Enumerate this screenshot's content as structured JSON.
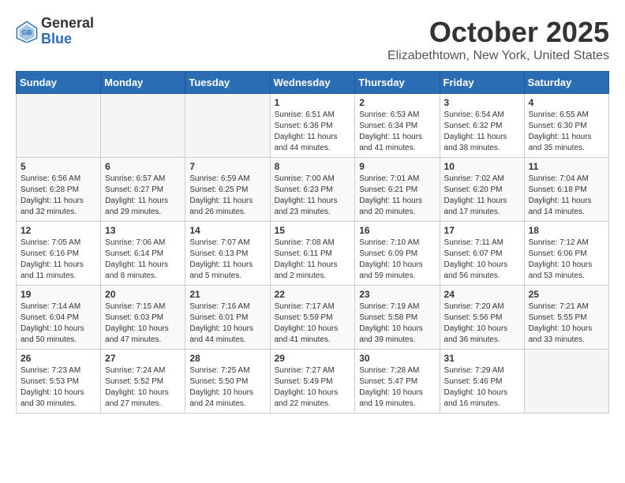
{
  "header": {
    "logo": {
      "general": "General",
      "blue": "Blue"
    },
    "title": "October 2025",
    "location": "Elizabethtown, New York, United States"
  },
  "days_of_week": [
    "Sunday",
    "Monday",
    "Tuesday",
    "Wednesday",
    "Thursday",
    "Friday",
    "Saturday"
  ],
  "weeks": [
    [
      {
        "day": "",
        "info": ""
      },
      {
        "day": "",
        "info": ""
      },
      {
        "day": "",
        "info": ""
      },
      {
        "day": "1",
        "info": "Sunrise: 6:51 AM\nSunset: 6:36 PM\nDaylight: 11 hours and 44 minutes."
      },
      {
        "day": "2",
        "info": "Sunrise: 6:53 AM\nSunset: 6:34 PM\nDaylight: 11 hours and 41 minutes."
      },
      {
        "day": "3",
        "info": "Sunrise: 6:54 AM\nSunset: 6:32 PM\nDaylight: 11 hours and 38 minutes."
      },
      {
        "day": "4",
        "info": "Sunrise: 6:55 AM\nSunset: 6:30 PM\nDaylight: 11 hours and 35 minutes."
      }
    ],
    [
      {
        "day": "5",
        "info": "Sunrise: 6:56 AM\nSunset: 6:28 PM\nDaylight: 11 hours and 32 minutes."
      },
      {
        "day": "6",
        "info": "Sunrise: 6:57 AM\nSunset: 6:27 PM\nDaylight: 11 hours and 29 minutes."
      },
      {
        "day": "7",
        "info": "Sunrise: 6:59 AM\nSunset: 6:25 PM\nDaylight: 11 hours and 26 minutes."
      },
      {
        "day": "8",
        "info": "Sunrise: 7:00 AM\nSunset: 6:23 PM\nDaylight: 11 hours and 23 minutes."
      },
      {
        "day": "9",
        "info": "Sunrise: 7:01 AM\nSunset: 6:21 PM\nDaylight: 11 hours and 20 minutes."
      },
      {
        "day": "10",
        "info": "Sunrise: 7:02 AM\nSunset: 6:20 PM\nDaylight: 11 hours and 17 minutes."
      },
      {
        "day": "11",
        "info": "Sunrise: 7:04 AM\nSunset: 6:18 PM\nDaylight: 11 hours and 14 minutes."
      }
    ],
    [
      {
        "day": "12",
        "info": "Sunrise: 7:05 AM\nSunset: 6:16 PM\nDaylight: 11 hours and 11 minutes."
      },
      {
        "day": "13",
        "info": "Sunrise: 7:06 AM\nSunset: 6:14 PM\nDaylight: 11 hours and 8 minutes."
      },
      {
        "day": "14",
        "info": "Sunrise: 7:07 AM\nSunset: 6:13 PM\nDaylight: 11 hours and 5 minutes."
      },
      {
        "day": "15",
        "info": "Sunrise: 7:08 AM\nSunset: 6:11 PM\nDaylight: 11 hours and 2 minutes."
      },
      {
        "day": "16",
        "info": "Sunrise: 7:10 AM\nSunset: 6:09 PM\nDaylight: 10 hours and 59 minutes."
      },
      {
        "day": "17",
        "info": "Sunrise: 7:11 AM\nSunset: 6:07 PM\nDaylight: 10 hours and 56 minutes."
      },
      {
        "day": "18",
        "info": "Sunrise: 7:12 AM\nSunset: 6:06 PM\nDaylight: 10 hours and 53 minutes."
      }
    ],
    [
      {
        "day": "19",
        "info": "Sunrise: 7:14 AM\nSunset: 6:04 PM\nDaylight: 10 hours and 50 minutes."
      },
      {
        "day": "20",
        "info": "Sunrise: 7:15 AM\nSunset: 6:03 PM\nDaylight: 10 hours and 47 minutes."
      },
      {
        "day": "21",
        "info": "Sunrise: 7:16 AM\nSunset: 6:01 PM\nDaylight: 10 hours and 44 minutes."
      },
      {
        "day": "22",
        "info": "Sunrise: 7:17 AM\nSunset: 5:59 PM\nDaylight: 10 hours and 41 minutes."
      },
      {
        "day": "23",
        "info": "Sunrise: 7:19 AM\nSunset: 5:58 PM\nDaylight: 10 hours and 39 minutes."
      },
      {
        "day": "24",
        "info": "Sunrise: 7:20 AM\nSunset: 5:56 PM\nDaylight: 10 hours and 36 minutes."
      },
      {
        "day": "25",
        "info": "Sunrise: 7:21 AM\nSunset: 5:55 PM\nDaylight: 10 hours and 33 minutes."
      }
    ],
    [
      {
        "day": "26",
        "info": "Sunrise: 7:23 AM\nSunset: 5:53 PM\nDaylight: 10 hours and 30 minutes."
      },
      {
        "day": "27",
        "info": "Sunrise: 7:24 AM\nSunset: 5:52 PM\nDaylight: 10 hours and 27 minutes."
      },
      {
        "day": "28",
        "info": "Sunrise: 7:25 AM\nSunset: 5:50 PM\nDaylight: 10 hours and 24 minutes."
      },
      {
        "day": "29",
        "info": "Sunrise: 7:27 AM\nSunset: 5:49 PM\nDaylight: 10 hours and 22 minutes."
      },
      {
        "day": "30",
        "info": "Sunrise: 7:28 AM\nSunset: 5:47 PM\nDaylight: 10 hours and 19 minutes."
      },
      {
        "day": "31",
        "info": "Sunrise: 7:29 AM\nSunset: 5:46 PM\nDaylight: 10 hours and 16 minutes."
      },
      {
        "day": "",
        "info": ""
      }
    ]
  ]
}
